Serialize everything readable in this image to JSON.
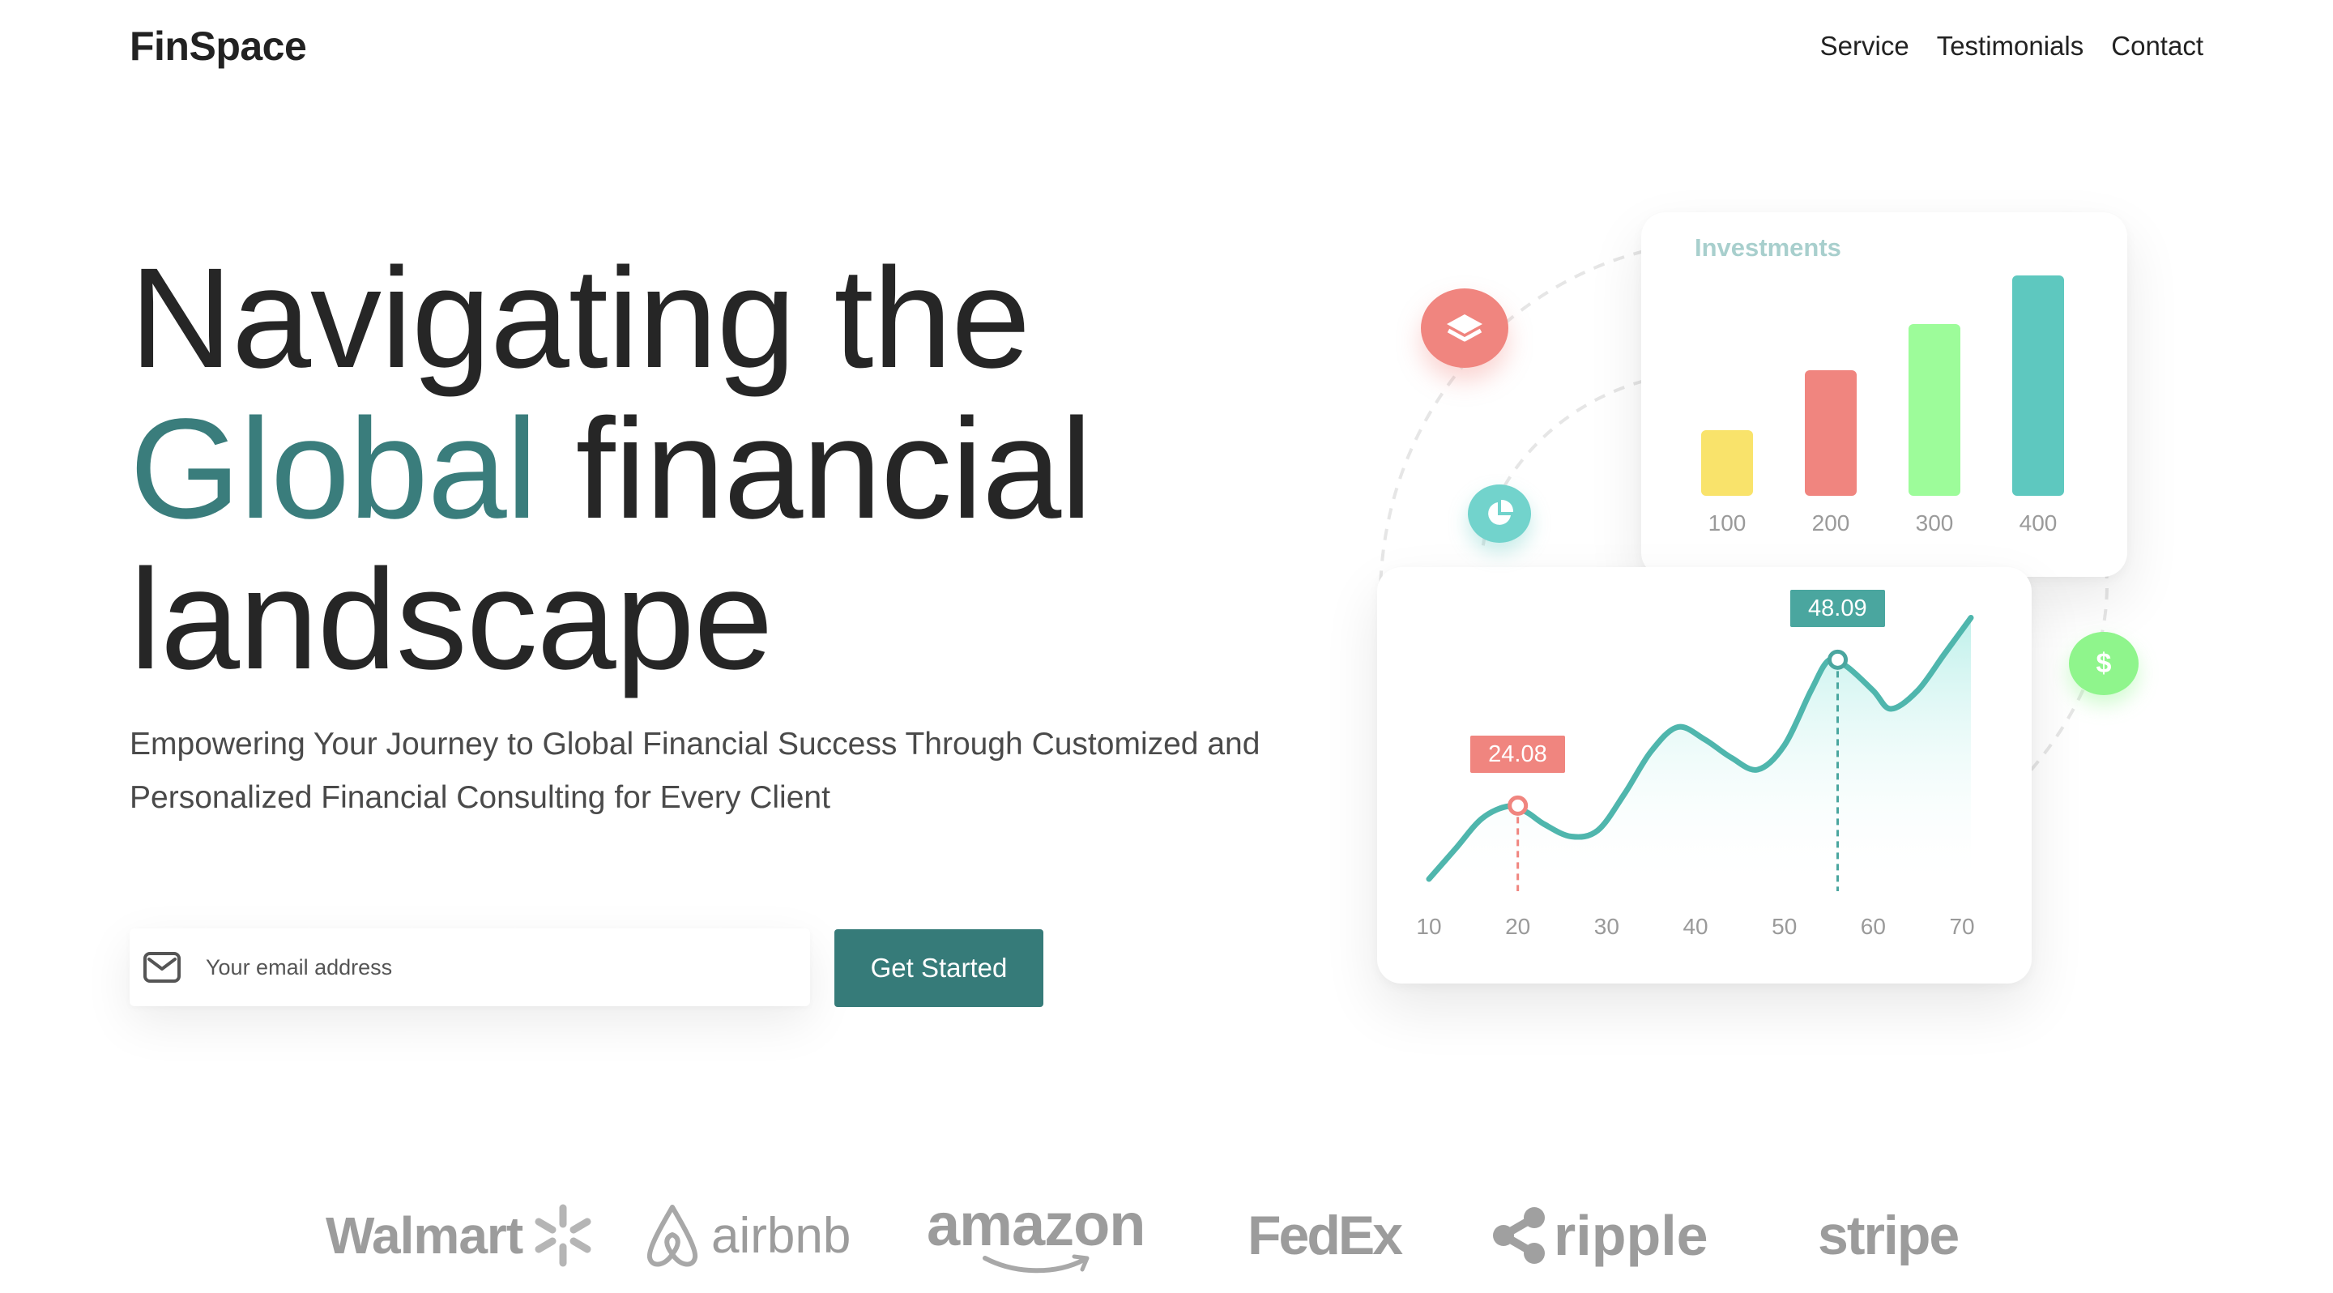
{
  "brand": "FinSpace",
  "nav": {
    "items": [
      {
        "label": "Service"
      },
      {
        "label": "Testimonials"
      },
      {
        "label": "Contact"
      }
    ]
  },
  "hero": {
    "line1": "Navigating the",
    "accent": "Global",
    "line2_rest": " financial",
    "line3": "landscape",
    "subtitle": "Empowering Your Journey to Global Financial Success Through Customized and Personalized Financial Consulting for Every Client"
  },
  "form": {
    "email_placeholder": "Your email address",
    "email_value": "",
    "cta_label": "Get Started"
  },
  "icons": {
    "mail": "mail-icon",
    "layers": "layers-icon",
    "pie": "pie-chart-icon",
    "dollar": "dollar-icon",
    "dollar_glyph": "$"
  },
  "colors": {
    "accent": "#367b79",
    "bar_yellow": "#f9e36b",
    "bar_red": "#f0857f",
    "bar_green": "#9dfc9a",
    "bar_teal": "#5ec8bf",
    "line": "#4fb6ad",
    "tag_red": "#f0857f",
    "tag_teal": "#4aa69f"
  },
  "chart_data": [
    {
      "type": "bar",
      "title": "Investments",
      "categories": [
        "100",
        "200",
        "300",
        "400"
      ],
      "values": [
        35,
        67,
        92,
        118
      ],
      "ylim": [
        0,
        130
      ],
      "grid": false
    },
    {
      "type": "area",
      "title": "",
      "x": [
        10,
        13,
        16,
        19,
        21,
        23,
        26,
        29,
        32,
        35,
        38,
        41,
        44,
        47,
        50,
        53,
        55,
        57,
        60,
        62,
        65,
        68,
        71
      ],
      "y": [
        12,
        17,
        22,
        24,
        23,
        21,
        19,
        20,
        26,
        33,
        37,
        35,
        32,
        30,
        34,
        43,
        48,
        47,
        43,
        40,
        43,
        49,
        55
      ],
      "xticks": [
        "10",
        "20",
        "30",
        "40",
        "50",
        "60",
        "70"
      ],
      "annotations": [
        {
          "x": 20,
          "y": 24.08,
          "label": "24.08"
        },
        {
          "x": 56,
          "y": 48.09,
          "label": "48.09"
        }
      ],
      "xlim": [
        10,
        72
      ],
      "ylim": [
        10,
        58
      ],
      "grid": false
    }
  ],
  "partners": [
    "Walmart",
    "airbnb",
    "amazon",
    "FedEx",
    "ripple",
    "stripe"
  ]
}
